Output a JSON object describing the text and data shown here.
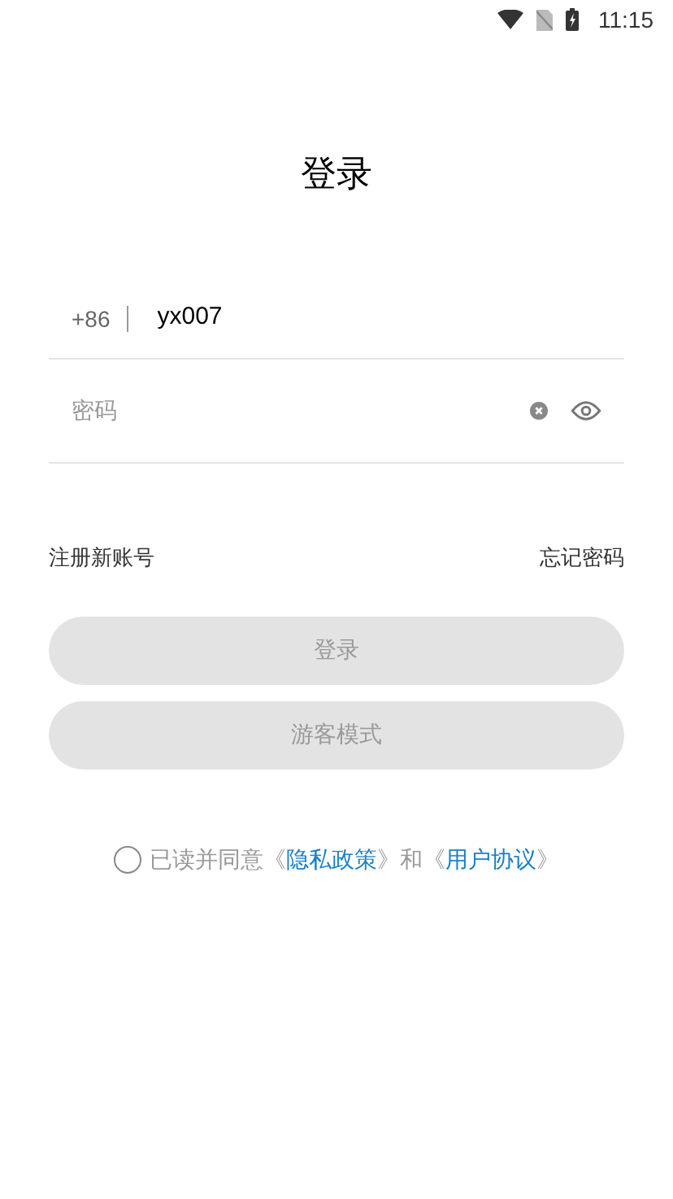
{
  "status_bar": {
    "time": "11:15"
  },
  "title": "登录",
  "phone": {
    "country_code": "+86",
    "value": "yx007"
  },
  "password": {
    "placeholder": "密码"
  },
  "links": [
    {
      "label": "注册新账号"
    },
    {
      "label": "忘记密码"
    }
  ],
  "buttons": [
    {
      "label": "登录",
      "disabled": true
    },
    {
      "label": "游客模式",
      "disabled": true
    }
  ],
  "agreement": {
    "checked": false,
    "parts": [
      {
        "kind": "text",
        "text": "已读并同意《"
      },
      {
        "kind": "link",
        "text": "隐私政策"
      },
      {
        "kind": "text",
        "text": "》和《"
      },
      {
        "kind": "link",
        "text": "用户协议"
      },
      {
        "kind": "text",
        "text": "》"
      }
    ]
  }
}
